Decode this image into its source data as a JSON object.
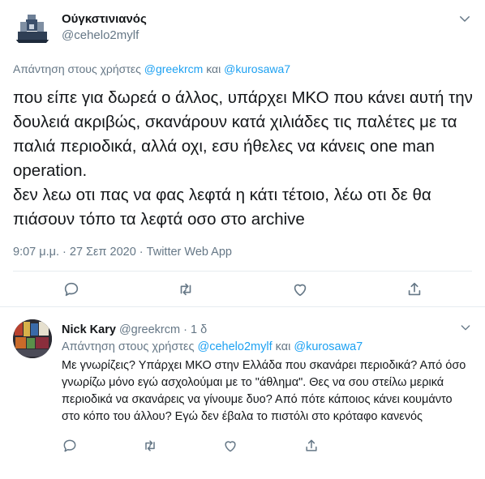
{
  "main_tweet": {
    "display_name": "Ούγκστινιανός",
    "handle": "@cehelo2mylf",
    "reply_prefix": "Απάντηση στους χρήστες",
    "reply_users": [
      "@greekrcm",
      "@kurosawa7"
    ],
    "reply_joiner": "και",
    "text": "που είπε για δωρεά ο άλλος, υπάρχει ΜΚΟ που κάνει αυτή την δουλειά ακριβώς, σκανάρουν κατά χιλιάδες τις παλέτες με τα παλιά περιοδικά, αλλά οχι, εσυ ήθελες να κάνεις one man operation.\nδεν λεω οτι πας να φας λεφτά η κάτι τέτοιο, λέω οτι δε θα πιάσουν τόπο τα λεφτά οσο στο archive",
    "timestamp": "9:07 μ.μ. · 27 Σεπ 2020 · Twitter Web App"
  },
  "reply_tweet": {
    "display_name": "Nick Kary",
    "handle": "@greekrcm",
    "separator": "·",
    "age": "1 δ",
    "reply_prefix": "Απάντηση στους χρήστες",
    "reply_users": [
      "@cehelo2mylf",
      "@kurosawa7"
    ],
    "reply_joiner": "και",
    "text": "Με γνωρίζεις? Υπάρχει ΜΚΟ στην Ελλάδα που σκανάρει περιοδικά? Από όσο γνωρίζω μόνο εγώ ασχολούμαι με το \"άθλημα\". Θες να σου στείλω μερικά περιοδικά να σκανάρεις να γίνουμε δυο? Από πότε κάποιος κάνει κουμάντο στο κόπο του άλλου? Εγώ δεν έβαλα το πιστόλι στο κρόταφο κανενός"
  },
  "icons": {
    "reply": "speech-bubble-icon",
    "retweet": "retweet-icon",
    "like": "heart-icon",
    "share": "share-icon",
    "more": "chevron-down-icon"
  },
  "colors": {
    "link": "#1da1f2",
    "secondary": "#657786",
    "text": "#14171a",
    "divider": "#e6ecf0"
  }
}
